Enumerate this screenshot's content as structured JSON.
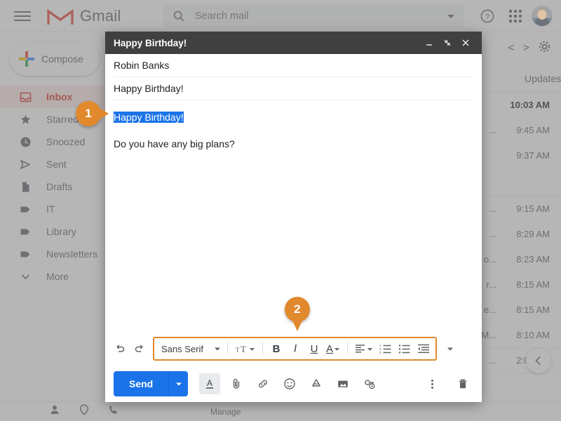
{
  "app": {
    "brand": "Gmail",
    "search_placeholder": "Search mail",
    "search_value": ""
  },
  "topbar": {
    "menu_icon": "hamburger-icon",
    "help_icon": "help-icon",
    "apps_icon": "apps-grid-icon",
    "avatar_icon": "user-avatar"
  },
  "sidebar": {
    "compose_label": "Compose",
    "items": [
      {
        "label": "Inbox",
        "icon": "inbox-icon",
        "active": true
      },
      {
        "label": "Starred",
        "icon": "star-icon",
        "active": false
      },
      {
        "label": "Snoozed",
        "icon": "clock-icon",
        "active": false
      },
      {
        "label": "Sent",
        "icon": "send-icon",
        "active": false
      },
      {
        "label": "Drafts",
        "icon": "draft-icon",
        "active": false
      },
      {
        "label": "IT",
        "icon": "label-icon",
        "active": false
      },
      {
        "label": "Library",
        "icon": "label-icon",
        "active": false
      },
      {
        "label": "Newsletters",
        "icon": "label-icon",
        "active": false
      },
      {
        "label": "More",
        "icon": "chevron-down-icon",
        "active": false
      }
    ]
  },
  "maillist": {
    "tab_updates": "Updates",
    "prev_label": "<",
    "next_label": ">",
    "rows": [
      {
        "snippet": "",
        "time": "10:03 AM",
        "unread": true
      },
      {
        "snippet": "...",
        "time": "9:45 AM",
        "unread": false
      },
      {
        "snippet": "",
        "time": "9:37 AM",
        "unread": false
      },
      {
        "snippet": "",
        "time": "",
        "unread": false
      },
      {
        "snippet": "...",
        "time": "9:15 AM",
        "unread": false
      },
      {
        "snippet": "...",
        "time": "8:29 AM",
        "unread": false
      },
      {
        "snippet": "o...",
        "time": "8:23 AM",
        "unread": false
      },
      {
        "snippet": "r...",
        "time": "8:15 AM",
        "unread": false
      },
      {
        "snippet": "e...",
        "time": "8:15 AM",
        "unread": false
      },
      {
        "snippet": "M...",
        "time": "8:10 AM",
        "unread": false
      },
      {
        "snippet": "...",
        "time": "2:00 AM",
        "unread": false
      }
    ]
  },
  "statusbar": {
    "manage_label": "Manage",
    "icons": [
      "person-icon",
      "chat-icon",
      "phone-icon"
    ]
  },
  "compose": {
    "title": "Happy Birthday!",
    "minimize_icon": "minimize-icon",
    "restore_icon": "restore-down-icon",
    "close_icon": "close-icon",
    "to_value": "Robin Banks",
    "subject_value": "Happy Birthday!",
    "body_selected_text": "Happy Birthday!",
    "body_line2": "Do you have any big plans?",
    "toolbar": {
      "undo_icon": "undo-icon",
      "redo_icon": "redo-icon",
      "font_name": "Sans Serif",
      "font_size_icon": "font-size-icon",
      "bold_label": "B",
      "italic_label": "I",
      "underline_label": "U",
      "text_color_label": "A",
      "align_icon": "align-left-icon",
      "numbered_list_icon": "numbered-list-icon",
      "bulleted_list_icon": "bulleted-list-icon",
      "indent_less_icon": "indent-less-icon",
      "more_options_icon": "chevron-down-icon"
    },
    "bottom": {
      "send_label": "Send",
      "send_caret_icon": "chevron-down-icon",
      "format_icon": "format-text-icon",
      "attach_icon": "attachment-icon",
      "link_icon": "link-icon",
      "emoji_icon": "emoji-icon",
      "drive_icon": "google-drive-icon",
      "image_icon": "insert-photo-icon",
      "confidential_icon": "confidential-mode-icon",
      "more_icon": "more-options-icon",
      "trash_icon": "trash-icon"
    }
  },
  "callouts": {
    "badge_1": "1",
    "badge_2": "2",
    "accent_color": "#e2892e"
  }
}
